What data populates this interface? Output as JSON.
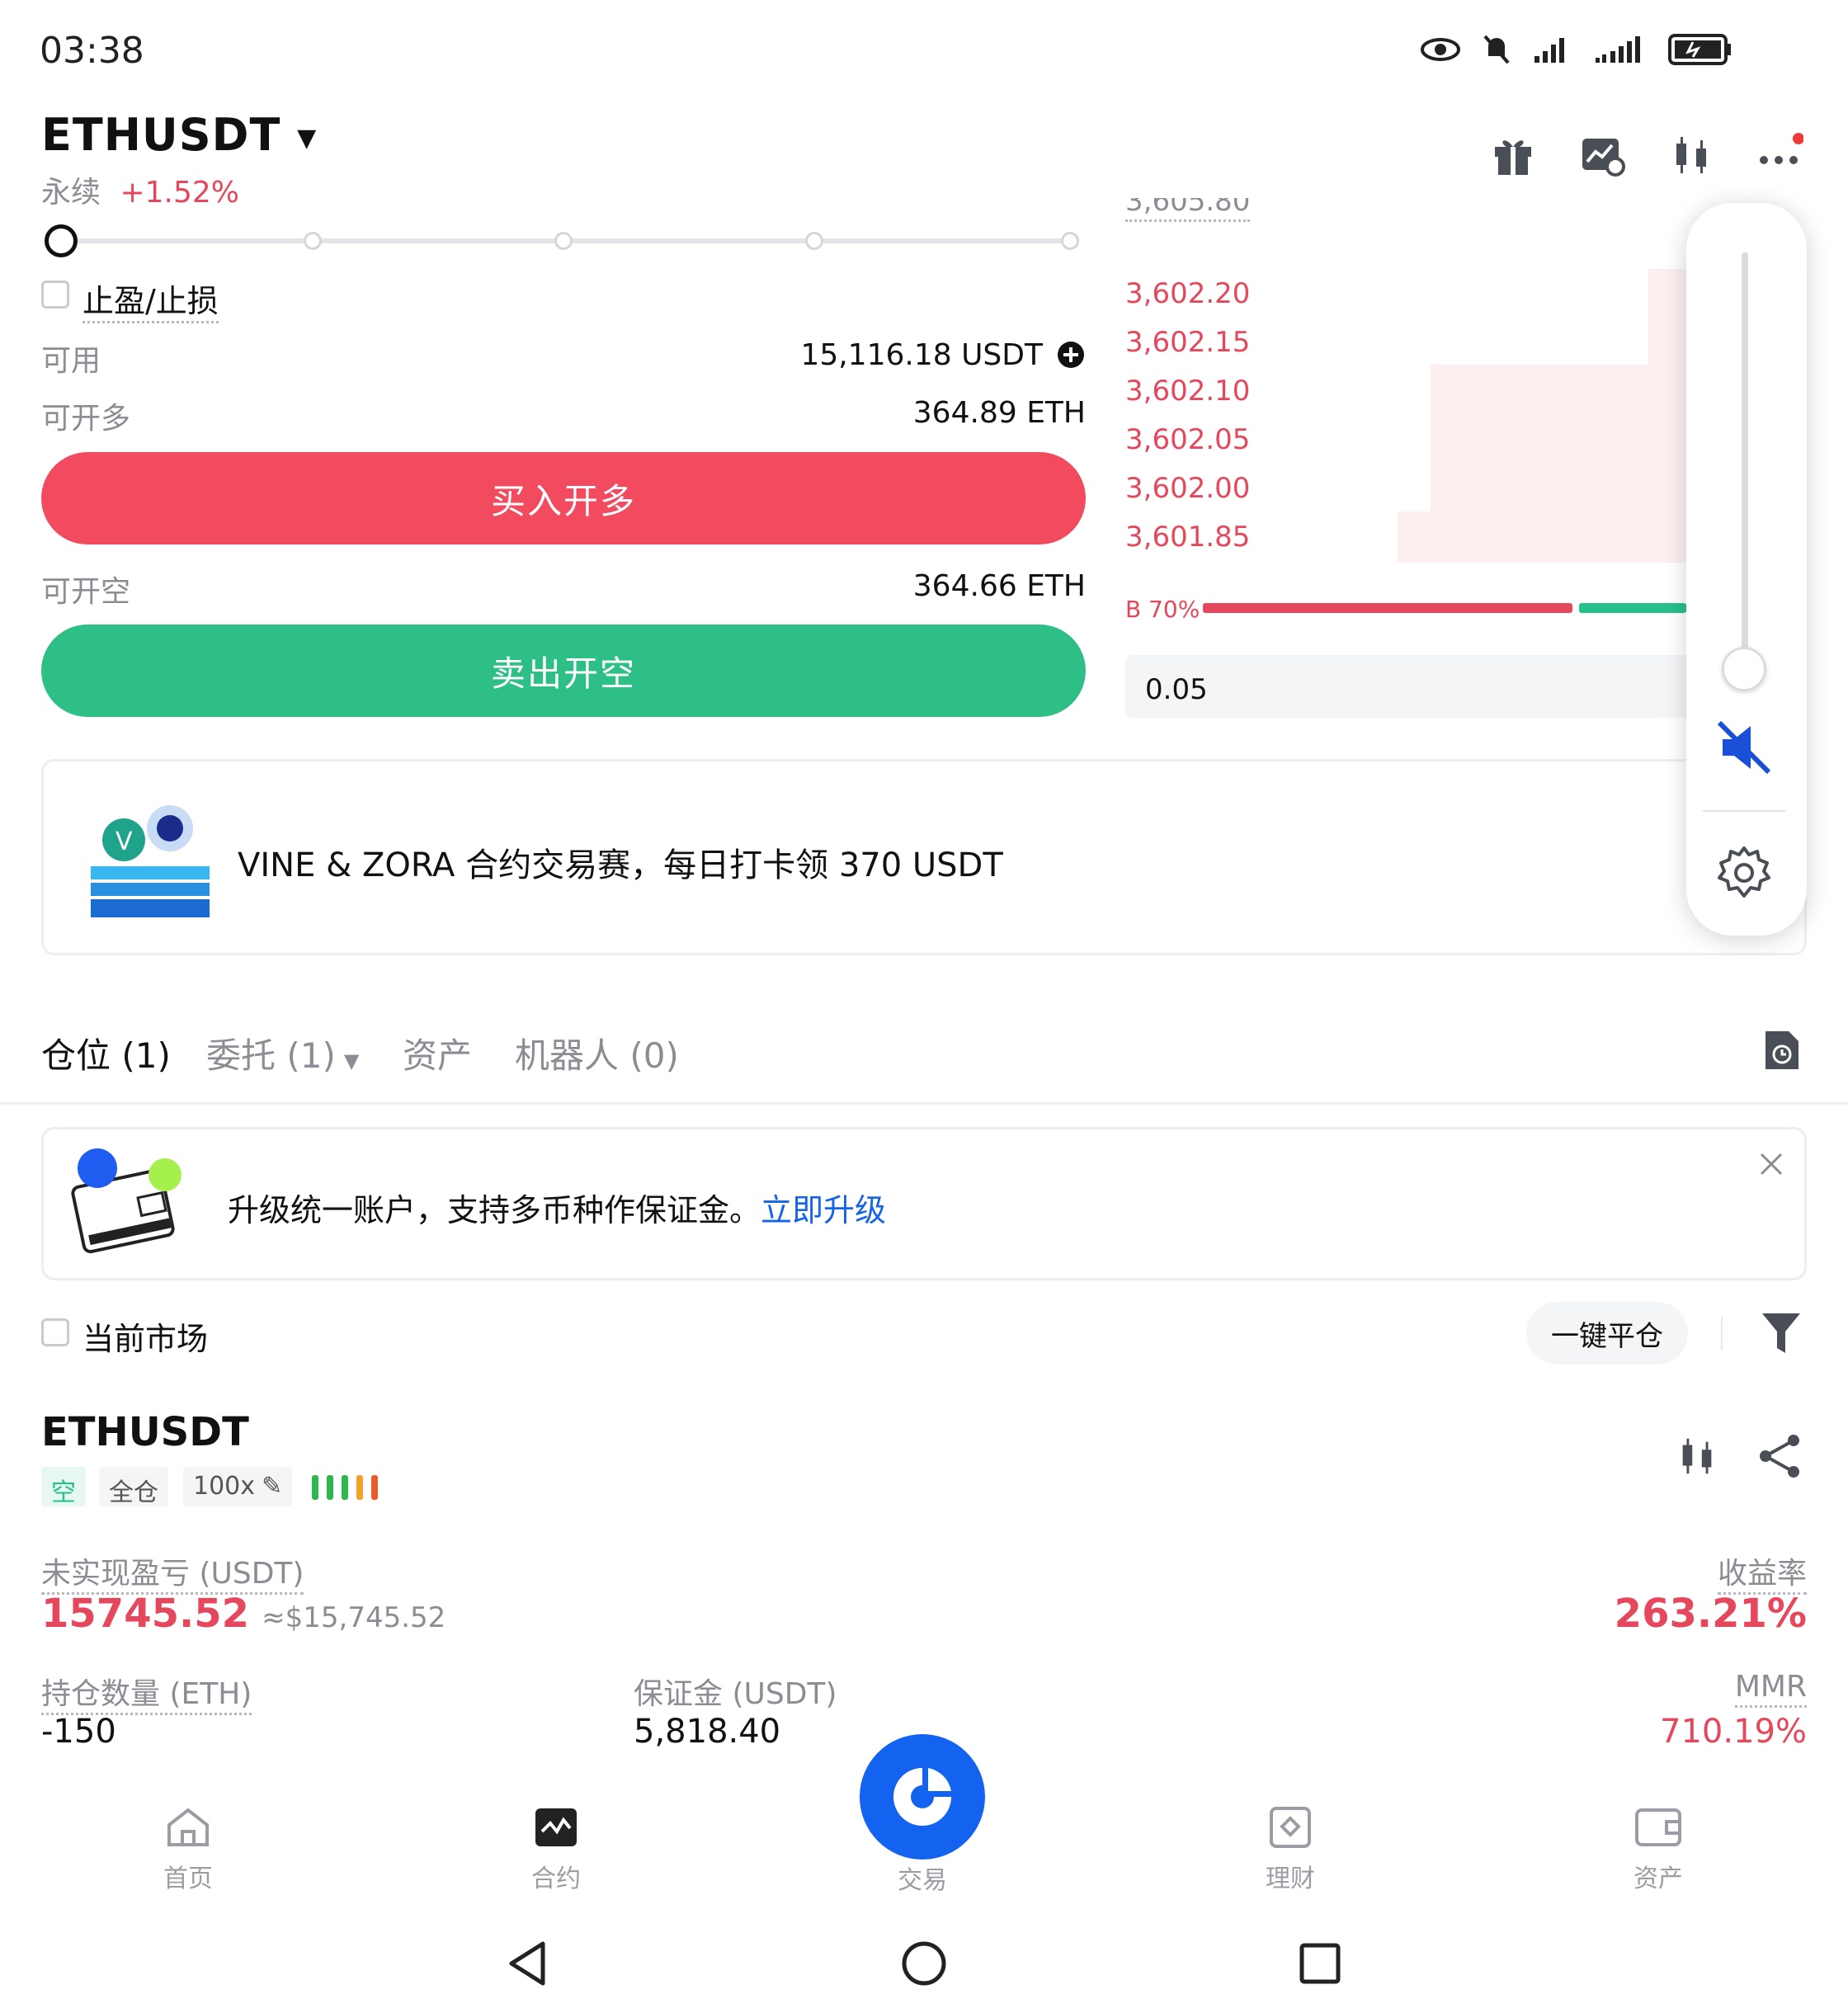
{
  "status_bar": {
    "time": "03:38"
  },
  "header": {
    "symbol": "ETHUSDT",
    "contract_type": "永续",
    "change": "+1.52%",
    "icons": [
      "gift-icon",
      "chart-settings-icon",
      "candlestick-icon",
      "more-icon"
    ]
  },
  "order_form": {
    "tp_sl_label": "止盈/止损",
    "available_label": "可用",
    "available_value": "15,116.18 USDT",
    "can_long_label": "可开多",
    "can_long_value": "364.89 ETH",
    "buy_button": "买入开多",
    "can_short_label": "可开空",
    "can_short_value": "364.66 ETH",
    "sell_button": "卖出开空"
  },
  "orderbook": {
    "top_price": "3,605.80",
    "asks": [
      "3,602.20",
      "3,602.15",
      "3,602.10",
      "3,602.05",
      "3,602.00",
      "3,601.85"
    ],
    "ratio_label": "B 70%",
    "buy_ratio": 0.7,
    "quantity": "0.05"
  },
  "promo_banner": {
    "text": "VINE & ZORA 合约交易赛，每日打卡领 370 USDT"
  },
  "tabs": [
    {
      "label": "仓位 (1)"
    },
    {
      "label": "委托 (1)"
    },
    {
      "label": "资产"
    },
    {
      "label": "机器人 (0)"
    }
  ],
  "upgrade_notice": {
    "text": "升级统一账户，支持多币种作保证金。",
    "link": "立即升级"
  },
  "filter": {
    "current_market_label": "当前市场",
    "close_all_button": "一键平仓"
  },
  "position": {
    "symbol": "ETHUSDT",
    "side": "空",
    "margin_mode": "全仓",
    "leverage": "100x",
    "unrealized_pnl_label": "未实现盈亏 (USDT)",
    "unrealized_pnl": "15745.52",
    "unrealized_pnl_usd": "≈$15,745.52",
    "roi_label": "收益率",
    "roi": "263.21%",
    "size_label": "持仓数量 (ETH)",
    "size": "-150",
    "margin_label": "保证金 (USDT)",
    "margin": "5,818.40",
    "mmr_label": "MMR",
    "mmr": "710.19%"
  },
  "bottom_nav": [
    {
      "label": "首页",
      "icon": "home-icon"
    },
    {
      "label": "合约",
      "icon": "futures-icon"
    },
    {
      "label": "交易",
      "icon": "trade-icon"
    },
    {
      "label": "理财",
      "icon": "earn-icon"
    },
    {
      "label": "资产",
      "icon": "wallet-icon"
    }
  ]
}
